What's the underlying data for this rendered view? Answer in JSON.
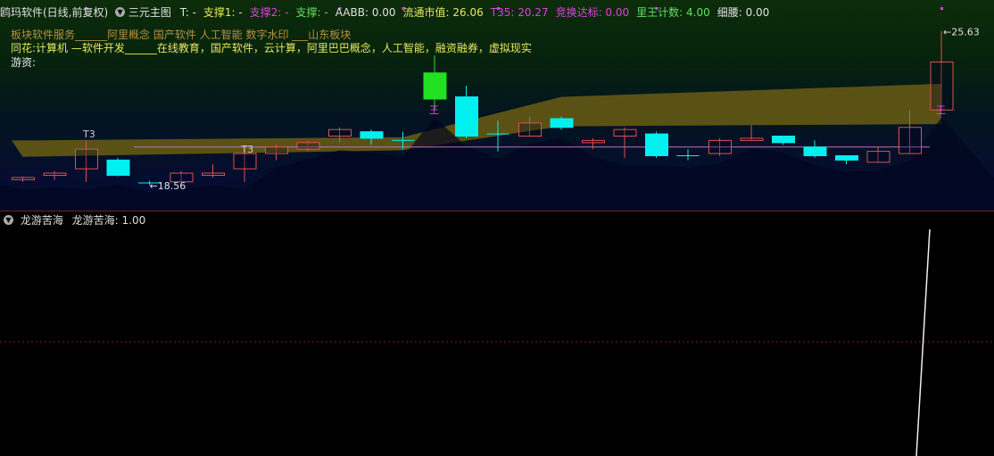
{
  "header": {
    "app_title": "鸥玛软件(日线,前复权)",
    "indicator_name": "三元主图",
    "items": [
      {
        "text": "T: -",
        "color": "#e0e0e0"
      },
      {
        "text": "支撑1: -",
        "color": "#e8e860"
      },
      {
        "text": "支撑2: -",
        "color": "#e040e0"
      },
      {
        "text": "支撑: -",
        "color": "#60e060"
      },
      {
        "text": "AABB: 0.00",
        "color": "#e0e0e0"
      },
      {
        "text": "流通市值: 26.06",
        "color": "#e8e860"
      },
      {
        "text": "T35: 20.27",
        "color": "#e040e0"
      },
      {
        "text": "竞换达标: 0.00",
        "color": "#e040e0"
      },
      {
        "text": "里王计数: 4.00",
        "color": "#60e060"
      },
      {
        "text": "细腰: 0.00",
        "color": "#e0e0e0"
      }
    ]
  },
  "board_text": "板块软件服务______阿里概念 国产软件 人工智能 数字水印 ___山东板块",
  "ths_label": "同花:",
  "ths_text": "计算机 —软件开发______在线教育，国产软件，云计算，阿里巴巴概念，人工智能，融资融券，虚拟现实",
  "youzi_label": "游资:",
  "price_labels": {
    "high": "25.63",
    "low": "18.56"
  },
  "markers": {
    "t3": "T3",
    "wang": "王"
  },
  "sub_panel": {
    "indicator_name": "龙游苦海",
    "value_label": "龙游苦海: 1.00"
  },
  "colors": {
    "up": "#e05050",
    "down": "#00f0f0",
    "band": "#5a5214",
    "support_line": "#c070c0",
    "magenta": "#e040e0"
  },
  "chart_data": {
    "type": "candlestick",
    "candles": [
      {
        "o": 18.8,
        "c": 18.9,
        "h": 18.95,
        "l": 18.7
      },
      {
        "o": 19.0,
        "c": 19.1,
        "h": 19.2,
        "l": 18.8
      },
      {
        "o": 19.3,
        "c": 20.2,
        "h": 20.6,
        "l": 18.7
      },
      {
        "o": 19.7,
        "c": 19.0,
        "h": 19.8,
        "l": 18.95
      },
      {
        "o": 18.65,
        "c": 18.65,
        "h": 18.75,
        "l": 18.56
      },
      {
        "o": 18.7,
        "c": 19.1,
        "h": 19.2,
        "l": 18.7
      },
      {
        "o": 19.0,
        "c": 19.1,
        "h": 19.5,
        "l": 18.9
      },
      {
        "o": 19.3,
        "c": 20.0,
        "h": 20.2,
        "l": 18.7
      },
      {
        "o": 20.0,
        "c": 20.3,
        "h": 20.4,
        "l": 19.7
      },
      {
        "o": 20.2,
        "c": 20.5,
        "h": 20.6,
        "l": 20.1
      },
      {
        "o": 20.8,
        "c": 21.1,
        "h": 21.2,
        "l": 20.5
      },
      {
        "o": 21.0,
        "c": 20.7,
        "h": 21.1,
        "l": 20.4
      },
      {
        "o": 20.6,
        "c": 20.6,
        "h": 21.0,
        "l": 20.2
      },
      {
        "o": 23.7,
        "c": 22.5,
        "h": 24.5,
        "l": 22.0
      },
      {
        "o": 22.6,
        "c": 20.8,
        "h": 23.1,
        "l": 20.7
      },
      {
        "o": 20.9,
        "c": 20.9,
        "h": 21.5,
        "l": 20.1
      },
      {
        "o": 20.8,
        "c": 21.4,
        "h": 21.7,
        "l": 20.8
      },
      {
        "o": 21.6,
        "c": 21.2,
        "h": 21.7,
        "l": 21.1
      },
      {
        "o": 20.5,
        "c": 20.6,
        "h": 20.7,
        "l": 20.2
      },
      {
        "o": 20.8,
        "c": 21.1,
        "h": 21.2,
        "l": 19.8
      },
      {
        "o": 20.9,
        "c": 19.9,
        "h": 21.0,
        "l": 19.8
      },
      {
        "o": 19.9,
        "c": 19.9,
        "h": 20.2,
        "l": 19.7
      },
      {
        "o": 20.0,
        "c": 20.6,
        "h": 20.7,
        "l": 19.9
      },
      {
        "o": 20.6,
        "c": 20.7,
        "h": 21.3,
        "l": 20.6
      },
      {
        "o": 20.8,
        "c": 20.5,
        "h": 20.8,
        "l": 20.4
      },
      {
        "o": 20.3,
        "c": 19.9,
        "h": 20.6,
        "l": 19.8
      },
      {
        "o": 19.9,
        "c": 19.7,
        "h": 19.9,
        "l": 19.5
      },
      {
        "o": 19.6,
        "c": 20.1,
        "h": 20.3,
        "l": 19.6
      },
      {
        "o": 20.0,
        "c": 21.2,
        "h": 22.0,
        "l": 20.0
      },
      {
        "o": 22.0,
        "c": 24.2,
        "h": 25.63,
        "l": 22.0
      }
    ],
    "support_level": 20.3,
    "ylim": [
      18.2,
      25.9
    ]
  }
}
